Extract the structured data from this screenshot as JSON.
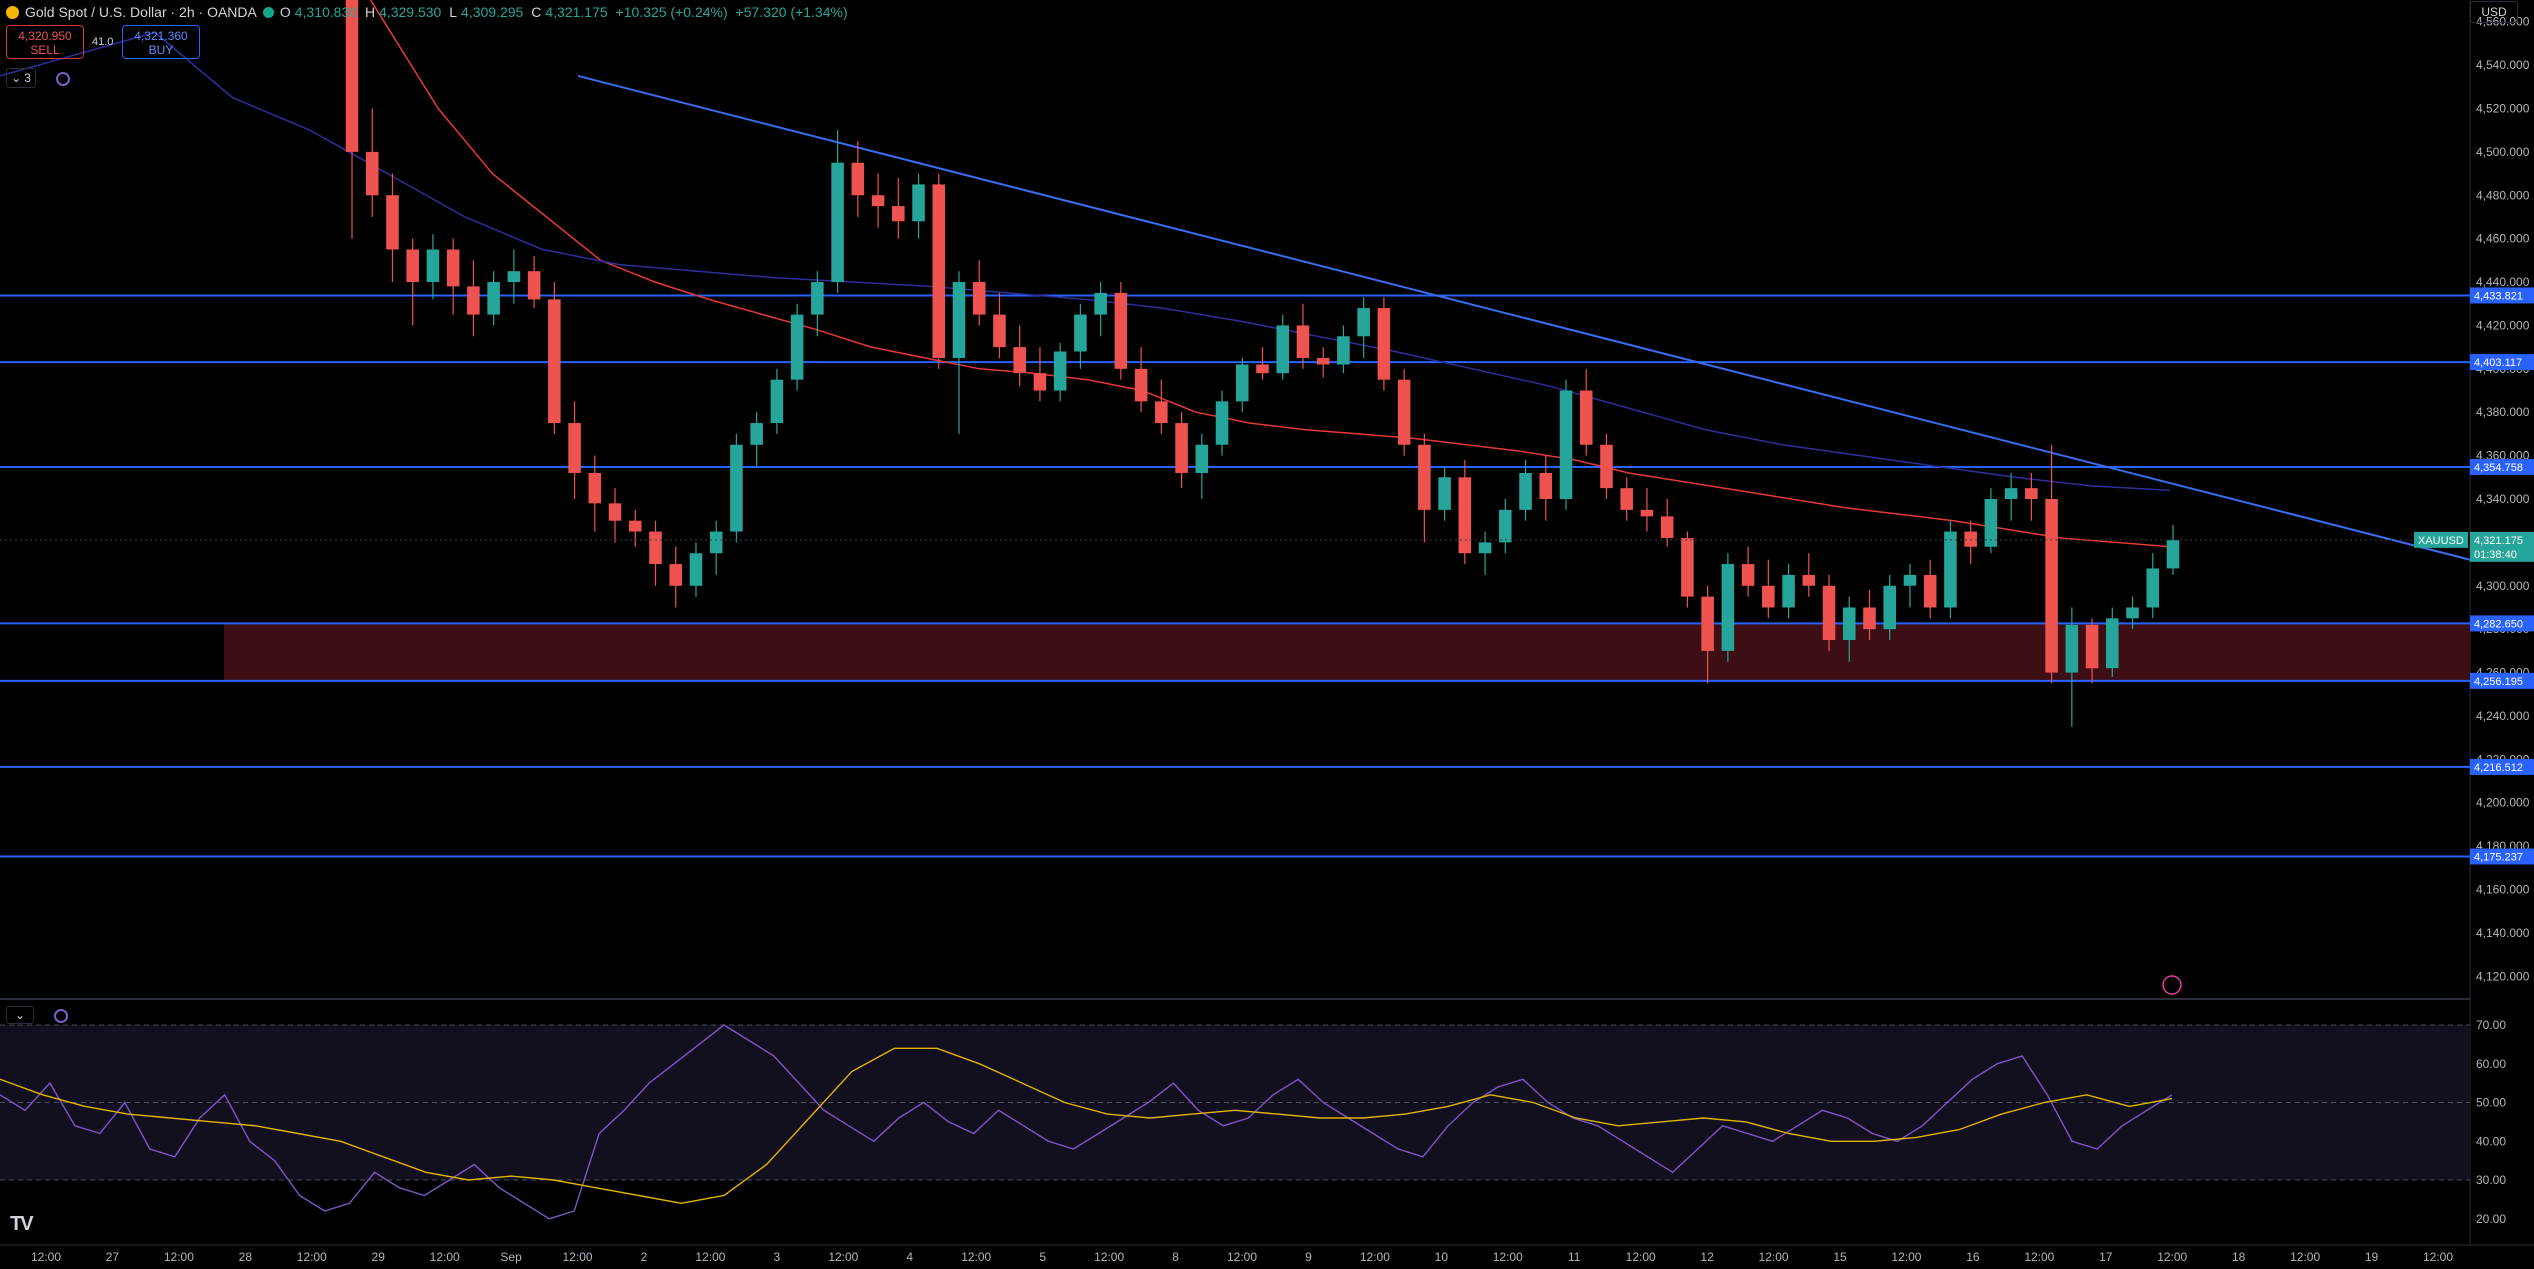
{
  "header": {
    "symbol_title": "Gold Spot / U.S. Dollar · 2h · OANDA",
    "ohlc": {
      "o_key": "O",
      "o_val": "4,310.830",
      "h_key": "H",
      "h_val": "4,329.530",
      "l_key": "L",
      "l_val": "4,309.295",
      "c_key": "C",
      "c_val": "4,321.175",
      "change": "+10.325 (+0.24%)",
      "change2": "+57.320 (+1.34%)"
    },
    "sell_price": "4,320.950",
    "sell_label": "SELL",
    "buy_price": "4,321.360",
    "buy_label": "BUY",
    "spread": "41.0",
    "indicators_count": "3",
    "currency": "USD"
  },
  "colors": {
    "background": "#000000",
    "up": "#26a69a",
    "down": "#ef5350",
    "hline": "#2962ff",
    "trendline": "#3a6df0",
    "ma_red": "#e53935",
    "ma_blue": "#2d2f9a",
    "zone": "#3d0f15",
    "rsi": "#7e57c2",
    "rsi_ma": "#e0b400"
  },
  "chart_data": [
    {
      "type": "candlestick",
      "title": "Gold Spot / U.S. Dollar · 2h · OANDA",
      "symbol": "XAUUSD",
      "ylim": [
        4110,
        4570
      ],
      "y_ticks": [
        "4,560.000",
        "4,540.000",
        "4,520.000",
        "4,500.000",
        "4,480.000",
        "4,460.000",
        "4,440.000",
        "4,420.000",
        "4,400.000",
        "4,380.000",
        "4,360.000",
        "4,340.000",
        "4,320.000",
        "4,300.000",
        "4,280.000",
        "4,260.000",
        "4,240.000",
        "4,220.000",
        "4,200.000",
        "4,180.000",
        "4,160.000",
        "4,140.000",
        "4,120.000"
      ],
      "x_ticks": [
        "12:00",
        "27",
        "12:00",
        "28",
        "12:00",
        "29",
        "12:00",
        "Sep",
        "12:00",
        "2",
        "12:00",
        "3",
        "12:00",
        "4",
        "12:00",
        "5",
        "12:00",
        "8",
        "12:00",
        "9",
        "12:00",
        "10",
        "12:00",
        "11",
        "12:00",
        "12",
        "12:00",
        "15",
        "12:00",
        "16",
        "12:00",
        "17",
        "12:00",
        "18",
        "12:00",
        "19",
        "12:00"
      ],
      "horizontal_levels": [
        {
          "value": 4433.821,
          "label": "4,433.821"
        },
        {
          "value": 4403.117,
          "label": "4,403.117"
        },
        {
          "value": 4354.758,
          "label": "4,354.758"
        },
        {
          "value": 4282.65,
          "label": "4,282.650"
        },
        {
          "value": 4256.195,
          "label": "4,256.195"
        },
        {
          "value": 4216.512,
          "label": "4,216.512"
        },
        {
          "value": 4175.237,
          "label": "4,175.237"
        }
      ],
      "zone": {
        "top": 4282.65,
        "bottom": 4256.195
      },
      "trendline": {
        "from": 4535,
        "to": 4312
      },
      "last_price": {
        "symbol": "XAUUSD",
        "label": "4,321.175",
        "value": 4321.175,
        "countdown": "01:38:40"
      },
      "candles_ohlc": [
        [
          4590,
          4600,
          4460,
          4500
        ],
        [
          4500,
          4520,
          4470,
          4480
        ],
        [
          4480,
          4490,
          4440,
          4455
        ],
        [
          4455,
          4460,
          4420,
          4440
        ],
        [
          4440,
          4462,
          4432,
          4455
        ],
        [
          4455,
          4460,
          4425,
          4438
        ],
        [
          4438,
          4450,
          4415,
          4425
        ],
        [
          4425,
          4445,
          4420,
          4440
        ],
        [
          4440,
          4455,
          4430,
          4445
        ],
        [
          4445,
          4452,
          4428,
          4432
        ],
        [
          4432,
          4440,
          4370,
          4375
        ],
        [
          4375,
          4385,
          4340,
          4352
        ],
        [
          4352,
          4360,
          4325,
          4338
        ],
        [
          4338,
          4345,
          4320,
          4330
        ],
        [
          4330,
          4335,
          4318,
          4325
        ],
        [
          4325,
          4330,
          4300,
          4310
        ],
        [
          4310,
          4318,
          4290,
          4300
        ],
        [
          4300,
          4320,
          4295,
          4315
        ],
        [
          4315,
          4330,
          4305,
          4325
        ],
        [
          4325,
          4370,
          4320,
          4365
        ],
        [
          4365,
          4380,
          4355,
          4375
        ],
        [
          4375,
          4400,
          4370,
          4395
        ],
        [
          4395,
          4430,
          4390,
          4425
        ],
        [
          4425,
          4445,
          4415,
          4440
        ],
        [
          4440,
          4510,
          4435,
          4495
        ],
        [
          4495,
          4505,
          4470,
          4480
        ],
        [
          4480,
          4490,
          4465,
          4475
        ],
        [
          4475,
          4488,
          4460,
          4468
        ],
        [
          4468,
          4490,
          4460,
          4485
        ],
        [
          4485,
          4490,
          4400,
          4405
        ],
        [
          4405,
          4445,
          4370,
          4440
        ],
        [
          4440,
          4450,
          4420,
          4425
        ],
        [
          4425,
          4435,
          4405,
          4410
        ],
        [
          4410,
          4420,
          4392,
          4398
        ],
        [
          4398,
          4410,
          4385,
          4390
        ],
        [
          4390,
          4412,
          4385,
          4408
        ],
        [
          4408,
          4430,
          4400,
          4425
        ],
        [
          4425,
          4440,
          4415,
          4435
        ],
        [
          4435,
          4440,
          4395,
          4400
        ],
        [
          4400,
          4410,
          4380,
          4385
        ],
        [
          4385,
          4395,
          4370,
          4375
        ],
        [
          4375,
          4380,
          4345,
          4352
        ],
        [
          4352,
          4370,
          4340,
          4365
        ],
        [
          4365,
          4390,
          4360,
          4385
        ],
        [
          4385,
          4405,
          4380,
          4402
        ],
        [
          4402,
          4410,
          4395,
          4398
        ],
        [
          4398,
          4425,
          4395,
          4420
        ],
        [
          4420,
          4430,
          4400,
          4405
        ],
        [
          4405,
          4410,
          4396,
          4402
        ],
        [
          4402,
          4420,
          4398,
          4415
        ],
        [
          4415,
          4433,
          4405,
          4428
        ],
        [
          4428,
          4433,
          4390,
          4395
        ],
        [
          4395,
          4400,
          4360,
          4365
        ],
        [
          4365,
          4370,
          4320,
          4335
        ],
        [
          4335,
          4355,
          4330,
          4350
        ],
        [
          4350,
          4358,
          4310,
          4315
        ],
        [
          4315,
          4325,
          4305,
          4320
        ],
        [
          4320,
          4340,
          4315,
          4335
        ],
        [
          4335,
          4358,
          4330,
          4352
        ],
        [
          4352,
          4360,
          4330,
          4340
        ],
        [
          4340,
          4395,
          4335,
          4390
        ],
        [
          4390,
          4400,
          4360,
          4365
        ],
        [
          4365,
          4370,
          4340,
          4345
        ],
        [
          4345,
          4350,
          4330,
          4335
        ],
        [
          4335,
          4345,
          4325,
          4332
        ],
        [
          4332,
          4340,
          4318,
          4322
        ],
        [
          4322,
          4325,
          4290,
          4295
        ],
        [
          4295,
          4300,
          4255,
          4270
        ],
        [
          4270,
          4315,
          4265,
          4310
        ],
        [
          4310,
          4318,
          4295,
          4300
        ],
        [
          4300,
          4312,
          4285,
          4290
        ],
        [
          4290,
          4310,
          4285,
          4305
        ],
        [
          4305,
          4315,
          4295,
          4300
        ],
        [
          4300,
          4305,
          4270,
          4275
        ],
        [
          4275,
          4295,
          4265,
          4290
        ],
        [
          4290,
          4298,
          4275,
          4280
        ],
        [
          4280,
          4305,
          4275,
          4300
        ],
        [
          4300,
          4310,
          4290,
          4305
        ],
        [
          4305,
          4312,
          4285,
          4290
        ],
        [
          4290,
          4330,
          4285,
          4325
        ],
        [
          4325,
          4330,
          4310,
          4318
        ],
        [
          4318,
          4345,
          4315,
          4340
        ],
        [
          4340,
          4352,
          4330,
          4345
        ],
        [
          4345,
          4352,
          4330,
          4340
        ],
        [
          4340,
          4365,
          4255,
          4260
        ],
        [
          4260,
          4290,
          4235,
          4282
        ],
        [
          4282,
          4285,
          4255,
          4262
        ],
        [
          4262,
          4290,
          4258,
          4285
        ],
        [
          4285,
          4295,
          4280,
          4290
        ],
        [
          4290,
          4315,
          4285,
          4308
        ],
        [
          4308,
          4328,
          4305,
          4321
        ]
      ],
      "moving_averages": [
        {
          "name": "MA red",
          "color": "#e53935",
          "values": [
            4600,
            4560,
            4520,
            4490,
            4470,
            4450,
            4440,
            4432,
            4425,
            4418,
            4410,
            4405,
            4400,
            4398,
            4395,
            4390,
            4380,
            4375,
            4372,
            4370,
            4368,
            4365,
            4362,
            4358,
            4352,
            4348,
            4344,
            4340,
            4336,
            4333,
            4330,
            4326,
            4322,
            4320,
            4318
          ]
        },
        {
          "name": "MA blue",
          "color": "#2d2f9a",
          "values": [
            4535,
            4545,
            4555,
            4525,
            4510,
            4490,
            4470,
            4455,
            4448,
            4445,
            4442,
            4440,
            4438,
            4435,
            4432,
            4428,
            4422,
            4415,
            4408,
            4400,
            4392,
            4382,
            4372,
            4365,
            4360,
            4355,
            4350,
            4346,
            4344
          ]
        }
      ]
    },
    {
      "type": "line",
      "title": "RSI",
      "ylim": [
        20,
        75
      ],
      "y_ticks": [
        "70.00",
        "60.00",
        "50.00",
        "40.00",
        "30.00",
        "20.00"
      ],
      "levels": [
        70,
        50,
        30
      ],
      "series": [
        {
          "name": "RSI",
          "color": "#7e57c2",
          "values": [
            52,
            48,
            55,
            44,
            42,
            50,
            38,
            36,
            46,
            52,
            40,
            35,
            26,
            22,
            24,
            32,
            28,
            26,
            30,
            34,
            28,
            24,
            20,
            22,
            42,
            48,
            55,
            60,
            65,
            70,
            66,
            62,
            55,
            48,
            44,
            40,
            46,
            50,
            45,
            42,
            48,
            44,
            40,
            38,
            42,
            46,
            50,
            55,
            48,
            44,
            46,
            52,
            56,
            50,
            46,
            42,
            38,
            36,
            44,
            50,
            54,
            56,
            50,
            46,
            44,
            40,
            36,
            32,
            38,
            44,
            42,
            40,
            44,
            48,
            46,
            42,
            40,
            44,
            50,
            56,
            60,
            62,
            52,
            40,
            38,
            44,
            48,
            52
          ]
        },
        {
          "name": "RSI MA",
          "color": "#e0b400",
          "values": [
            56,
            52,
            49,
            47,
            46,
            45,
            44,
            42,
            40,
            36,
            32,
            30,
            31,
            30,
            28,
            26,
            24,
            26,
            34,
            46,
            58,
            64,
            64,
            60,
            55,
            50,
            47,
            46,
            47,
            48,
            47,
            46,
            46,
            47,
            49,
            52,
            50,
            46,
            44,
            45,
            46,
            45,
            42,
            40,
            40,
            41,
            43,
            47,
            50,
            52,
            49,
            51
          ]
        }
      ]
    }
  ]
}
